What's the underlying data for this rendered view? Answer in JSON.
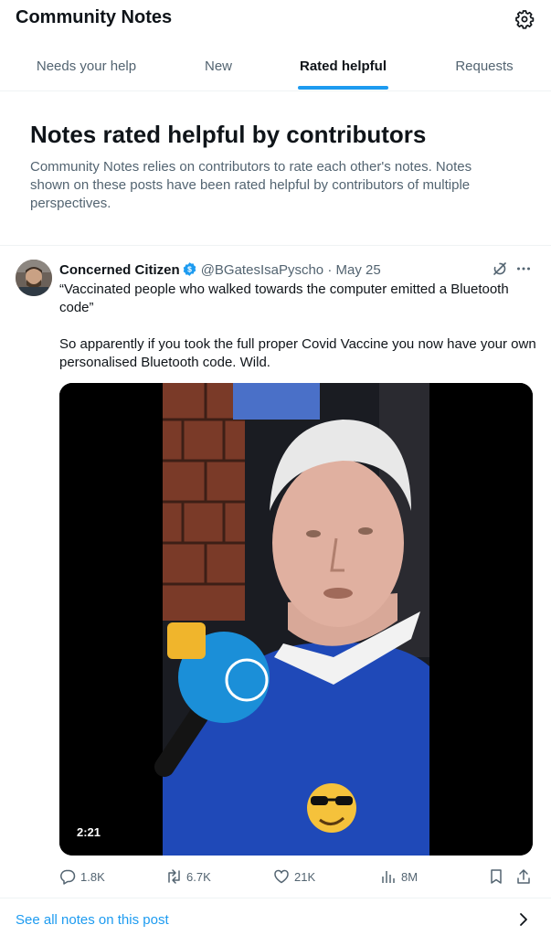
{
  "header": {
    "title": "Community Notes",
    "settings_icon": "gear-icon"
  },
  "tabs": [
    {
      "label": "Needs your help",
      "active": false
    },
    {
      "label": "New",
      "active": false
    },
    {
      "label": "Rated helpful",
      "active": true
    },
    {
      "label": "Requests",
      "active": false
    }
  ],
  "hero": {
    "title": "Notes rated helpful by contributors",
    "description": "Community Notes relies on contributors to rate each other's notes. Notes shown on these posts have been rated helpful by contributors of multiple perspectives."
  },
  "post": {
    "author_name": "Concerned Citizen",
    "author_handle": "@BGatesIsaPyscho",
    "separator": "·",
    "date": "May 25",
    "text_line_1": "“Vaccinated people who walked towards the computer emitted a Bluetooth code”",
    "text_line_2": "So apparently if you took the full proper Covid Vaccine you now have your own personalised Bluetooth code.  Wild.",
    "video_duration": "2:21",
    "stats": {
      "replies": "1.8K",
      "reposts": "6.7K",
      "likes": "21K",
      "views": "8M"
    }
  },
  "footer": {
    "see_all_label": "See all notes on this post"
  },
  "colors": {
    "accent": "#1d9bf0",
    "text_primary": "#0f1419",
    "text_secondary": "#536471",
    "divider": "#eff3f4"
  }
}
